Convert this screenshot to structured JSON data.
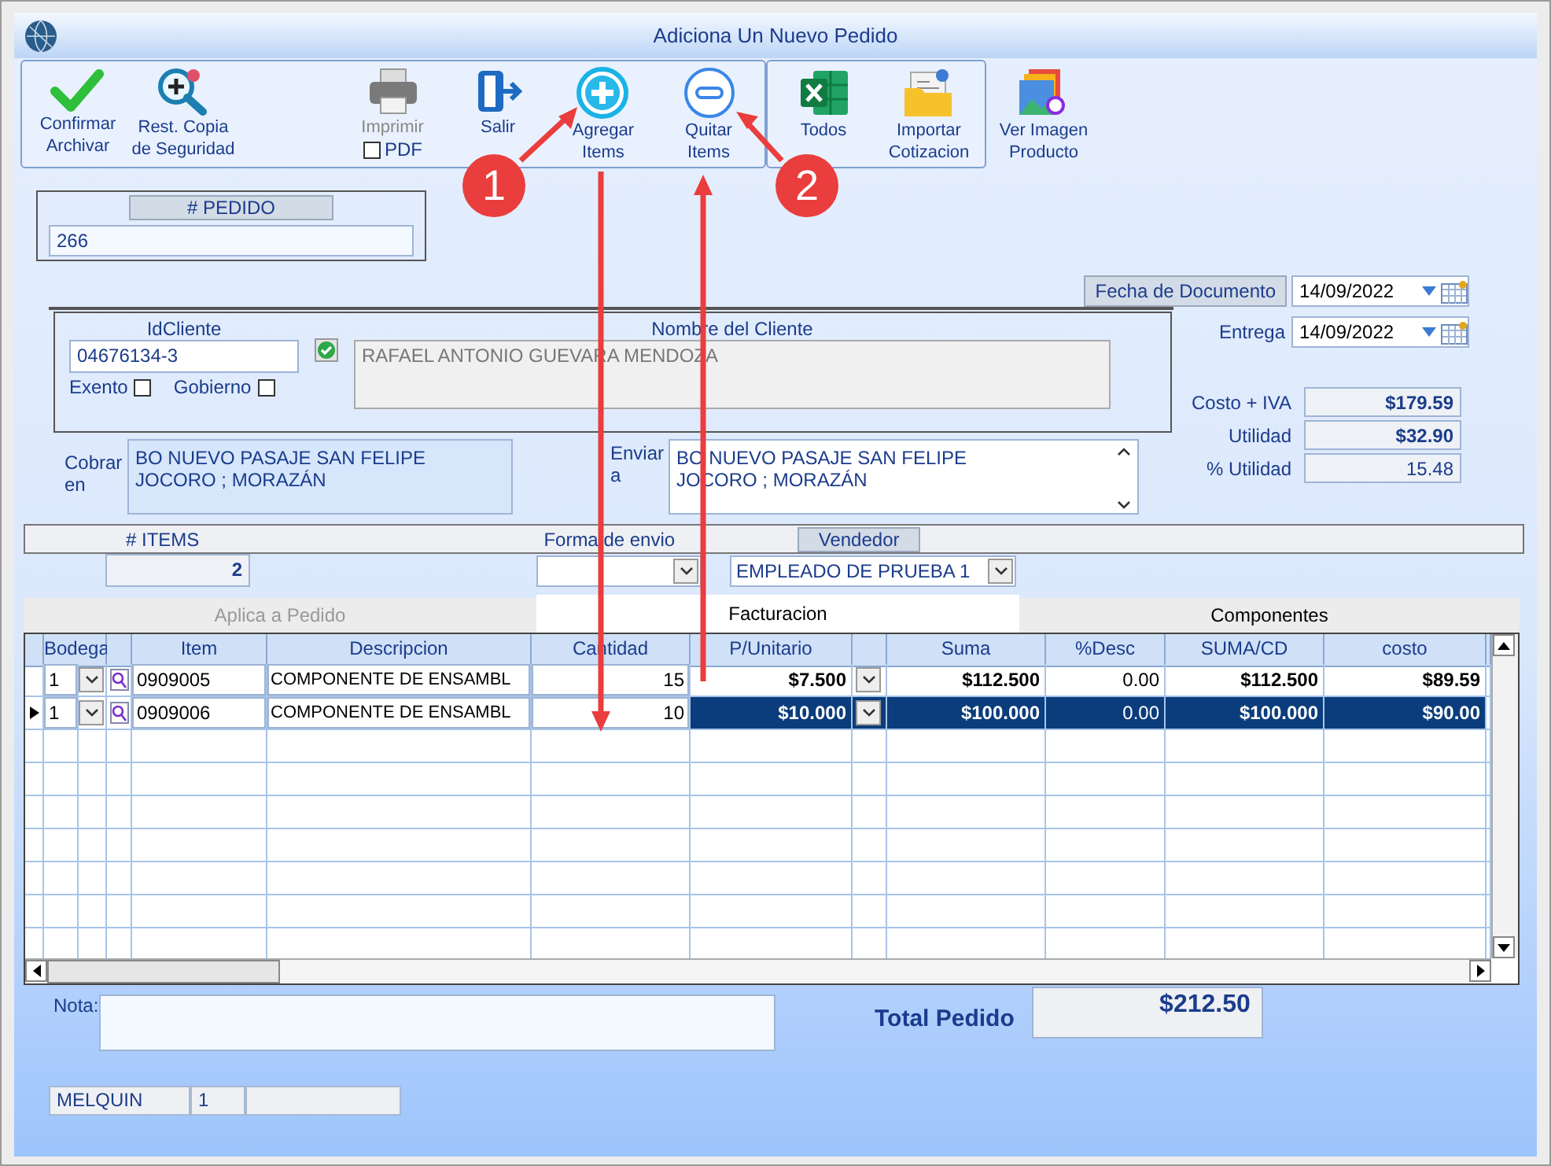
{
  "window": {
    "title": "Adiciona Un Nuevo Pedido"
  },
  "toolbar": [
    {
      "framed": true,
      "buttons": [
        {
          "kind": "confirm",
          "lines": [
            "Confirmar",
            "Archivar"
          ],
          "disabled": false
        },
        {
          "kind": "restore",
          "lines": [
            "Rest. Copia",
            "de Seguridad"
          ],
          "disabled": false
        },
        {
          "kind": "print",
          "lines": [
            "Imprimir"
          ],
          "disabled": true,
          "option": {
            "label": "PDF",
            "checked": false
          }
        },
        {
          "kind": "exit",
          "lines": [
            "Salir"
          ],
          "disabled": false
        },
        {
          "kind": "add",
          "lines": [
            "Agregar",
            "Items"
          ],
          "disabled": false
        },
        {
          "kind": "remove",
          "lines": [
            "Quitar",
            "Items"
          ],
          "disabled": false
        }
      ]
    },
    {
      "framed": true,
      "buttons": [
        {
          "kind": "excel",
          "lines": [
            "Todos"
          ],
          "disabled": false
        },
        {
          "kind": "import",
          "lines": [
            "Importar",
            "Cotizacion"
          ],
          "disabled": false
        }
      ]
    },
    {
      "framed": false,
      "buttons": [
        {
          "kind": "image",
          "lines": [
            "Ver Imagen",
            "Producto"
          ],
          "disabled": false
        }
      ]
    }
  ],
  "order": {
    "label": "# PEDIDO",
    "value": "266"
  },
  "document_date": {
    "label": "Fecha de  Documento",
    "value": "14/09/2022"
  },
  "client": {
    "id_label": "IdCliente",
    "id_value": "04676134-3",
    "exempt": {
      "label": "Exento",
      "checked": false
    },
    "government": {
      "label": "Gobierno",
      "checked": false
    },
    "name_label": "Nombre del Cliente",
    "name_value": "RAFAEL ANTONIO GUEVARA MENDOZA"
  },
  "delivery_date": {
    "label": "Entrega",
    "value": "14/09/2022"
  },
  "totals": [
    {
      "label": "Costo + IVA",
      "value": "$179.59",
      "bold": true
    },
    {
      "label": "Utilidad",
      "value": "$32.90",
      "bold": true
    },
    {
      "label": "% Utilidad",
      "value": "15.48",
      "bold": false
    }
  ],
  "billing": {
    "label_lines": [
      "Cobrar",
      "en"
    ],
    "address": [
      "BO NUEVO PASAJE SAN FELIPE",
      "JOCORO ; MORAZÁN"
    ]
  },
  "shipping": {
    "label_lines": [
      "Enviar",
      "a"
    ],
    "address": [
      "BO NUEVO PASAJE SAN FELIPE",
      "JOCORO ; MORAZÁN"
    ]
  },
  "items_bar": {
    "items_label": "# ITEMS",
    "items_count": "2",
    "shipping_method_label": "Forma de envio",
    "seller_label": "Vendedor",
    "seller_value": "EMPLEADO DE PRUEBA 1"
  },
  "tabs": [
    {
      "label": "Aplica a Pedido",
      "selected": false,
      "disabled": true
    },
    {
      "label": "Facturacion",
      "selected": true,
      "disabled": false
    },
    {
      "label": "Componentes",
      "selected": false,
      "disabled": false
    }
  ],
  "table": {
    "columns": [
      "Bodega",
      "Item",
      "Descripcion",
      "Cantidad",
      "P/Unitario",
      "Suma",
      "%Desc",
      "SUMA/CD",
      "costo"
    ],
    "rows": [
      {
        "selected": false,
        "cells": [
          "1",
          "0909005",
          "COMPONENTE DE ENSAMBL",
          "15",
          "$7.500",
          "$112.500",
          "0.00",
          "$112.500",
          "$89.59"
        ]
      },
      {
        "selected": true,
        "cells": [
          "1",
          "0909006",
          "COMPONENTE DE ENSAMBL",
          "10",
          "$10.000",
          "$100.000",
          "0.00",
          "$100.000",
          "$90.00"
        ]
      }
    ]
  },
  "note": {
    "label": "Nota:"
  },
  "total": {
    "label": "Total Pedido",
    "value": "$212.50"
  },
  "status_bar": [
    "MELQUIN",
    "1"
  ],
  "annotations": [
    {
      "label": "1"
    },
    {
      "label": "2"
    }
  ]
}
